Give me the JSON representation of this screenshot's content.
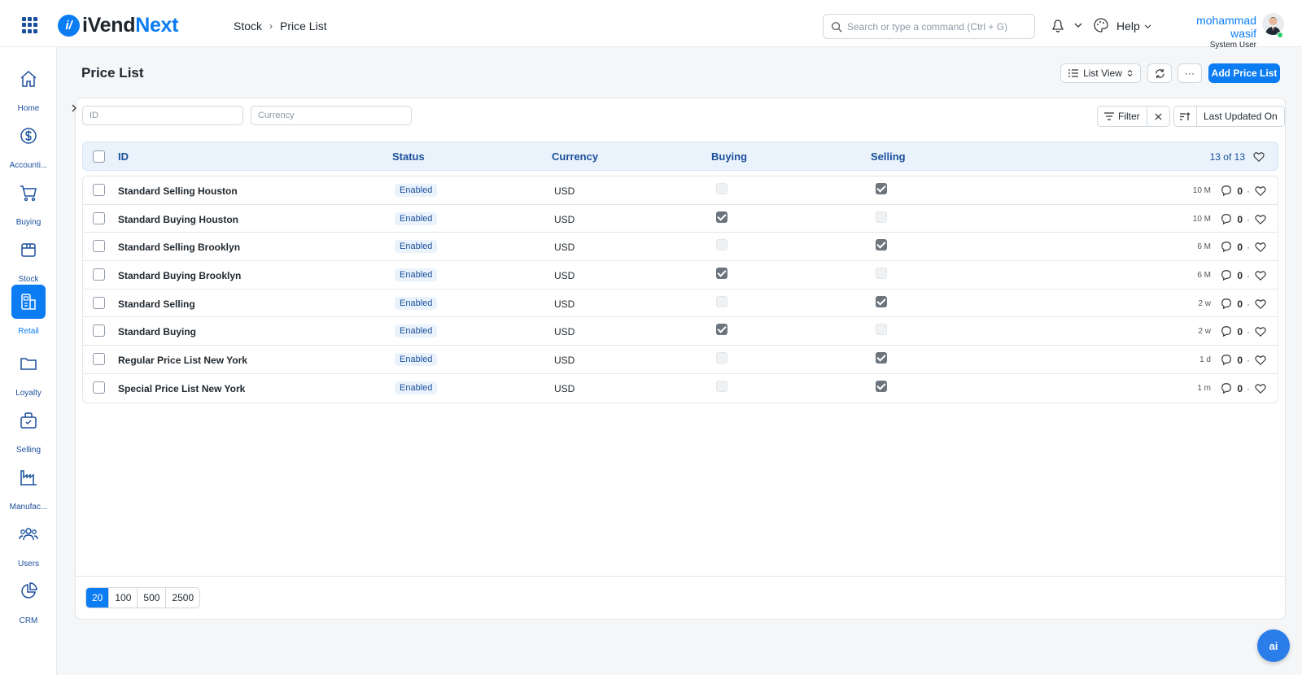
{
  "app": {
    "logo_prefix": "iVend",
    "logo_suffix": "Next",
    "logo_mark": "i/"
  },
  "breadcrumb": [
    "Stock",
    "Price List"
  ],
  "search": {
    "placeholder": "Search or type a command (Ctrl + G)"
  },
  "header": {
    "help_label": "Help"
  },
  "user": {
    "name": "mohammad wasif",
    "role": "System User"
  },
  "sidebar": {
    "items": [
      {
        "label": "Home",
        "icon": "home-icon"
      },
      {
        "label": "Accounti...",
        "icon": "dollar-icon"
      },
      {
        "label": "Buying",
        "icon": "cart-icon"
      },
      {
        "label": "Stock",
        "icon": "box-icon"
      },
      {
        "label": "Retail",
        "icon": "pos-icon",
        "active": true
      },
      {
        "label": "Loyalty",
        "icon": "folder-icon"
      },
      {
        "label": "Selling",
        "icon": "shopping-bag-icon"
      },
      {
        "label": "Manufac...",
        "icon": "factory-icon"
      },
      {
        "label": "Users",
        "icon": "users-icon"
      },
      {
        "label": "CRM",
        "icon": "pie-chart-icon"
      }
    ]
  },
  "page": {
    "title": "Price List",
    "list_view_label": "List View",
    "more_label": "···",
    "add_label": "Add Price List"
  },
  "filters": {
    "id_placeholder": "ID",
    "currency_placeholder": "Currency",
    "filter_label": "Filter",
    "sort_label": "Last Updated On"
  },
  "table": {
    "columns": {
      "id": "ID",
      "status": "Status",
      "currency": "Currency",
      "buying": "Buying",
      "selling": "Selling"
    },
    "count": "13 of 13",
    "rows": [
      {
        "id": "Standard Selling Houston",
        "status": "Enabled",
        "currency": "USD",
        "buying": false,
        "selling": true,
        "modified": "10 M",
        "comments": "0"
      },
      {
        "id": "Standard Buying Houston",
        "status": "Enabled",
        "currency": "USD",
        "buying": true,
        "selling": false,
        "modified": "10 M",
        "comments": "0"
      },
      {
        "id": "Standard Selling Brooklyn",
        "status": "Enabled",
        "currency": "USD",
        "buying": false,
        "selling": true,
        "modified": "6 M",
        "comments": "0"
      },
      {
        "id": "Standard Buying Brooklyn",
        "status": "Enabled",
        "currency": "USD",
        "buying": true,
        "selling": false,
        "modified": "6 M",
        "comments": "0"
      },
      {
        "id": "Standard Selling",
        "status": "Enabled",
        "currency": "USD",
        "buying": false,
        "selling": true,
        "modified": "2 w",
        "comments": "0"
      },
      {
        "id": "Standard Buying",
        "status": "Enabled",
        "currency": "USD",
        "buying": true,
        "selling": false,
        "modified": "2 w",
        "comments": "0"
      },
      {
        "id": "Regular Price List New York",
        "status": "Enabled",
        "currency": "USD",
        "buying": false,
        "selling": true,
        "modified": "1 d",
        "comments": "0"
      },
      {
        "id": "Special Price List New York",
        "status": "Enabled",
        "currency": "USD",
        "buying": false,
        "selling": true,
        "modified": "1 m",
        "comments": "0"
      }
    ]
  },
  "paging": {
    "options": [
      "20",
      "100",
      "500",
      "2500"
    ],
    "selected": "20"
  },
  "assistant": {
    "label": "ai"
  },
  "colors": {
    "accent": "#0b7cf2",
    "nav_blue": "#1a4f9c"
  }
}
